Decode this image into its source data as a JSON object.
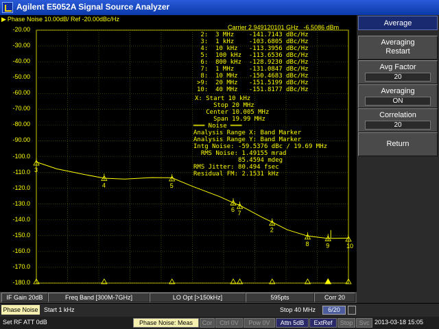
{
  "window": {
    "title": "Agilent E5052A Signal Source Analyzer",
    "icon": "app-icon"
  },
  "plot": {
    "header_marker": "▶",
    "header": "Phase Noise 10.00dB/ Ref -20.00dBc/Hz",
    "carrier": "Carrier 2.949120101 GHz   -6.5086 dBm",
    "y_labels": [
      "-20.00",
      "-30.00",
      "-40.00",
      "-50.00",
      "-60.00",
      "-70.00",
      "-80.00",
      "-90.00",
      "-100.0",
      "-110.0",
      "-120.0",
      "-130.0",
      "-140.0",
      "-150.0",
      "-160.0",
      "-170.0",
      "-180.0"
    ],
    "marker_table": [
      " 2:  3 MHz    -141.7143 dBc/Hz",
      " 3:  1 kHz    -103.6805 dBc/Hz",
      " 4:  10 kHz   -113.3956 dBc/Hz",
      " 5:  100 kHz  -113.6536 dBc/Hz",
      " 6:  800 kHz  -128.9230 dBc/Hz",
      " 7:  1 MHz    -131.0847 dBc/Hz",
      " 8:  10 MHz   -150.4683 dBc/Hz",
      ">9:  20 MHz   -151.5199 dBc/Hz",
      "10:  40 MHz   -151.8177 dBc/Hz"
    ],
    "span_block": [
      "X: Start 10 kHz",
      "     Stop 20 MHz",
      "   Center 10.005 MHz",
      "     Span 19.99 MHz"
    ],
    "noise_block": [
      "═══ Noise ═══",
      "Analysis Range X: Band Marker",
      "Analysis Range Y: Band Marker",
      "Intg Noise: -59.5376 dBc / 19.69 MHz",
      "  RMS Noise: 1.49155 mrad",
      "            85.4594 mdeg",
      "RMS Jitter: 80.494 fsec",
      "Residual FM: 2.1531 kHz"
    ],
    "markers": [
      {
        "label": "3",
        "x_hz": 1000,
        "y": -103.68
      },
      {
        "label": "4",
        "x_hz": 10000,
        "y": -113.4
      },
      {
        "label": "5",
        "x_hz": 100000,
        "y": -113.65
      },
      {
        "label": "6",
        "x_hz": 800000,
        "y": -128.92
      },
      {
        "label": "7",
        "x_hz": 1000000,
        "y": -131.08
      },
      {
        "label": "2",
        "x_hz": 3000000,
        "y": -141.71
      },
      {
        "label": "8",
        "x_hz": 10000000,
        "y": -150.47
      },
      {
        "label": "9",
        "x_hz": 20000000,
        "y": -151.52
      },
      {
        "label": "10",
        "x_hz": 40000000,
        "y": -151.82
      }
    ],
    "trace_color": "#ffff00"
  },
  "chart_data": {
    "type": "line",
    "title": "Phase Noise 10.00dB/ Ref -20.00dBc/Hz",
    "x_scale": "log",
    "xlim": [
      1000,
      40000000
    ],
    "ylim": [
      -180,
      -20
    ],
    "series": [
      {
        "x": [
          1000,
          2000,
          5000,
          10000,
          20000,
          50000,
          100000,
          200000,
          500000,
          800000,
          1000000,
          2000000,
          3000000,
          5000000,
          10000000,
          20000000,
          40000000
        ],
        "y": [
          -103.68,
          -107.5,
          -111.5,
          -113.4,
          -114.5,
          -113.0,
          -113.65,
          -118.5,
          -125.5,
          -128.92,
          -131.08,
          -137.5,
          -141.71,
          -146.0,
          -150.47,
          -151.52,
          -151.82
        ]
      }
    ]
  },
  "softkeys": {
    "title": "Average",
    "averaging_restart": [
      "Averaging",
      "Restart"
    ],
    "avg_factor_label": "Avg Factor",
    "avg_factor_value": "20",
    "averaging_label": "Averaging",
    "averaging_value": "ON",
    "correlation_label": "Correlation",
    "correlation_value": "20",
    "return": "Return"
  },
  "bottom_row1": {
    "if_gain": "IF Gain 20dB",
    "freq_band": "Freq Band [300M-7GHz]",
    "lo_opt": "LO Opt [>150kHz]",
    "points": "595pts",
    "corr": "Corr 20"
  },
  "bottom_row2": {
    "mode": "Phase Noise",
    "start": "Start 1 kHz",
    "stop": "Stop 40 MHz",
    "page": "6/20"
  },
  "status_bar": {
    "message": "Set RF ATT 0dB",
    "meas": "Phase Noise: Meas",
    "cor": "Cor",
    "ctrl": "Ctrl  0V",
    "pow": "Pow  0V",
    "attn": "Attn 5dB",
    "extref": "ExtRef",
    "stop": "Stop",
    "svc": "Svc",
    "datetime": "2013-03-18 15:05"
  }
}
